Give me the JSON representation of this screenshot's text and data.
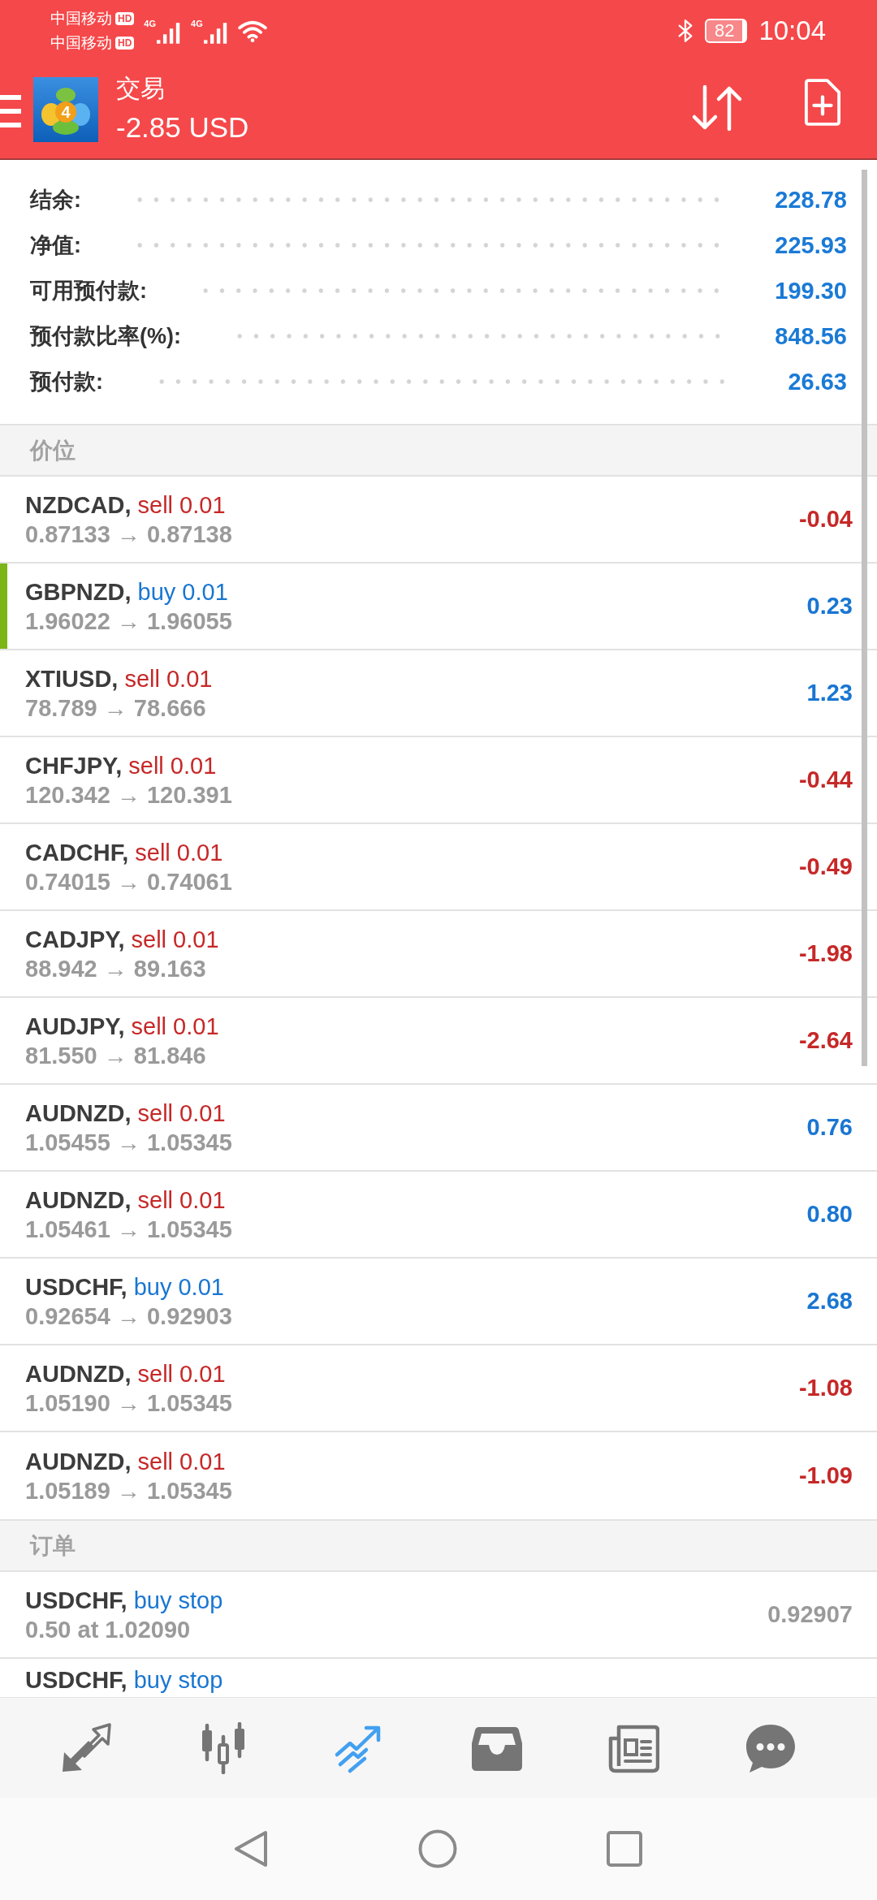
{
  "status_bar": {
    "carriers": [
      {
        "name": "中国移动",
        "badge": "HD"
      },
      {
        "name": "中国移动",
        "badge": "HD"
      }
    ],
    "signals": [
      "4G",
      "4G"
    ],
    "battery": "82",
    "time": "10:04"
  },
  "header": {
    "logo_text": "4",
    "title": "交易",
    "balance": "-2.85 USD"
  },
  "summary": [
    {
      "label": "结余:",
      "value": "228.78"
    },
    {
      "label": "净值:",
      "value": "225.93"
    },
    {
      "label": "可用预付款:",
      "value": "199.30"
    },
    {
      "label": "预付款比率(%):",
      "value": "848.56"
    },
    {
      "label": "预付款:",
      "value": "26.63"
    }
  ],
  "positions": {
    "title": "价位",
    "rows": [
      {
        "symbol": "NZDCAD,",
        "order": "sell 0.01",
        "kind": "sell",
        "prices": "0.87133 → 0.87138",
        "profit": "-0.04",
        "loss": true,
        "selected": false
      },
      {
        "symbol": "GBPNZD,",
        "order": "buy 0.01",
        "kind": "buy",
        "prices": "1.96022 → 1.96055",
        "profit": "0.23",
        "loss": false,
        "selected": true
      },
      {
        "symbol": "XTIUSD,",
        "order": "sell 0.01",
        "kind": "sell",
        "prices": "78.789 → 78.666",
        "profit": "1.23",
        "loss": false,
        "selected": false
      },
      {
        "symbol": "CHFJPY,",
        "order": "sell 0.01",
        "kind": "sell",
        "prices": "120.342 → 120.391",
        "profit": "-0.44",
        "loss": true,
        "selected": false
      },
      {
        "symbol": "CADCHF,",
        "order": "sell 0.01",
        "kind": "sell",
        "prices": "0.74015 → 0.74061",
        "profit": "-0.49",
        "loss": true,
        "selected": false
      },
      {
        "symbol": "CADJPY,",
        "order": "sell 0.01",
        "kind": "sell",
        "prices": "88.942 → 89.163",
        "profit": "-1.98",
        "loss": true,
        "selected": false
      },
      {
        "symbol": "AUDJPY,",
        "order": "sell 0.01",
        "kind": "sell",
        "prices": "81.550 → 81.846",
        "profit": "-2.64",
        "loss": true,
        "selected": false
      },
      {
        "symbol": "AUDNZD,",
        "order": "sell 0.01",
        "kind": "sell",
        "prices": "1.05455 → 1.05345",
        "profit": "0.76",
        "loss": false,
        "selected": false
      },
      {
        "symbol": "AUDNZD,",
        "order": "sell 0.01",
        "kind": "sell",
        "prices": "1.05461 → 1.05345",
        "profit": "0.80",
        "loss": false,
        "selected": false
      },
      {
        "symbol": "USDCHF,",
        "order": "buy 0.01",
        "kind": "buy",
        "prices": "0.92654 → 0.92903",
        "profit": "2.68",
        "loss": false,
        "selected": false
      },
      {
        "symbol": "AUDNZD,",
        "order": "sell 0.01",
        "kind": "sell",
        "prices": "1.05190 → 1.05345",
        "profit": "-1.08",
        "loss": true,
        "selected": false
      },
      {
        "symbol": "AUDNZD,",
        "order": "sell 0.01",
        "kind": "sell",
        "prices": "1.05189 → 1.05345",
        "profit": "-1.09",
        "loss": true,
        "selected": false
      }
    ]
  },
  "orders": {
    "title": "订单",
    "rows": [
      {
        "symbol": "USDCHF,",
        "order": "buy stop",
        "kind": "buy",
        "detail": "0.50 at 1.02090",
        "price": "0.92907"
      },
      {
        "symbol": "USDCHF,",
        "order": "buy stop",
        "kind": "buy"
      }
    ]
  },
  "bottom_nav": [
    {
      "kind": "quotes",
      "selected": false
    },
    {
      "kind": "chart",
      "selected": false
    },
    {
      "kind": "trade",
      "selected": true
    },
    {
      "kind": "history",
      "selected": false
    },
    {
      "kind": "news",
      "selected": false
    },
    {
      "kind": "chat",
      "selected": false
    }
  ]
}
